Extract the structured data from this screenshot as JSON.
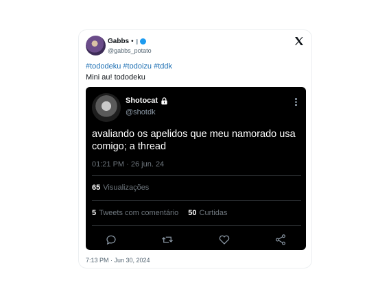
{
  "tweet": {
    "author_name": "Gabbs",
    "separator": "•",
    "handle": "@gabbs_potato",
    "hashtags": "#tododeku #todoizu #tddk",
    "text": "Mini au! tododeku",
    "timestamp": "7:13 PM · Jun 30, 2024"
  },
  "embedded": {
    "name": "Shotocat",
    "handle": "@shotdk",
    "text": "avaliando os apelidos que meu namorado usa comigo; a thread",
    "time": "01:21 PM · 26 jun. 24",
    "views_count": "65",
    "views_label": "Visualizações",
    "quotes_count": "5",
    "quotes_label": "Tweets com comentário",
    "likes_count": "50",
    "likes_label": "Curtidas"
  },
  "icons": {
    "x_logo": "x-logo-icon",
    "reply": "reply-icon",
    "retweet": "retweet-icon",
    "like": "heart-icon",
    "share": "share-icon",
    "lock": "lock-icon",
    "more": "more-icon"
  },
  "colors": {
    "link": "#1d6fb3",
    "embed_bg": "#000000",
    "muted": "#6e767d"
  }
}
